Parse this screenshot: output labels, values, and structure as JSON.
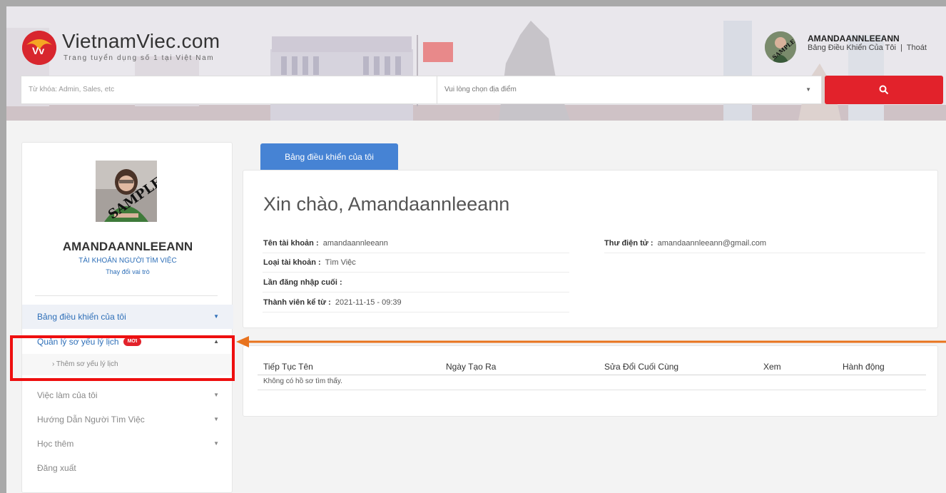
{
  "site": {
    "name": "VietnamViec.com",
    "tagline": "Trang tuyển dụng số 1 tại Việt Nam",
    "logo_initials": "Vv"
  },
  "header_user": {
    "name": "AMANDAANNLEEANN",
    "dashboard_link": "Bảng Điều Khiển Của Tôi",
    "separator": "|",
    "logout_link": "Thoát",
    "avatar_watermark": "SAMPLE"
  },
  "search": {
    "keyword_placeholder": "Từ khóa: Admin, Sales, etc",
    "location_placeholder": "Vui lòng chọn địa điểm",
    "button_icon": "search-icon"
  },
  "sidebar": {
    "photo_watermark": "SAMPLE",
    "user_name": "AMANDAANNLEEANN",
    "account_role": "TÀI KHOẢN NGƯỜI TÌM VIỆC",
    "change_role": "Thay đổi vai trò",
    "menu": [
      {
        "label": "Bảng điều khiển của tôi",
        "arrow": "chevron-down-icon"
      },
      {
        "label": "Quản lý sơ yếu lý lịch",
        "badge": "MỚI",
        "arrow": "chevron-up-icon"
      },
      {
        "label": "Việc làm của tôi",
        "arrow": "chevron-down-icon"
      },
      {
        "label": "Hướng Dẫn Người Tìm Việc",
        "arrow": "chevron-down-icon"
      },
      {
        "label": "Học thêm",
        "arrow": "chevron-down-icon"
      },
      {
        "label": "Đăng xuất"
      }
    ],
    "submenu": [
      {
        "label": "› Thêm sơ yếu lý lịch"
      }
    ]
  },
  "main": {
    "tab_label": "Bảng điều khiển của tôi",
    "greeting": "Xin chào, Amandaannleeann",
    "fields": {
      "account_name_label": "Tên tài khoản :",
      "account_name_value": "amandaannleeann",
      "account_type_label": "Loại tài khoản :",
      "account_type_value": "Tìm Việc",
      "last_login_label": "Lần đăng nhập cuối :",
      "last_login_value": "",
      "member_since_label": "Thành viên kể từ :",
      "member_since_value": "2021-11-15 - 09:39",
      "email_label": "Thư điện tử :",
      "email_value": "amandaannleeann@gmail.com"
    },
    "table": {
      "columns": [
        "Tiếp Tục Tên",
        "Ngày Tạo Ra",
        "Sửa Đổi Cuối Cùng",
        "Xem",
        "Hành động"
      ],
      "empty_message": "Không có hồ sơ tìm thấy."
    }
  },
  "colors": {
    "brand_red": "#e2222b",
    "tab_blue": "#4683d4",
    "link_blue": "#2e6fb8",
    "annotation_red": "#ee0f0f",
    "annotation_orange": "#e8731e"
  }
}
